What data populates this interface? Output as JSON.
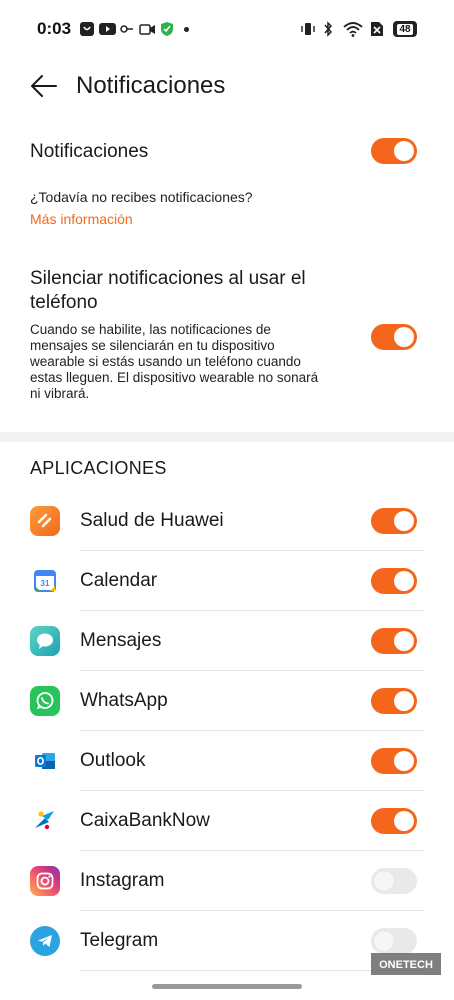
{
  "status_bar": {
    "time": "0:03",
    "battery": "48",
    "icons": [
      "notification-app-icon",
      "youtube-icon",
      "link-icon",
      "video-icon",
      "shield-icon",
      "more-dot-icon",
      "vibrate-icon",
      "bluetooth-icon",
      "wifi-icon",
      "sim-icon",
      "battery-icon"
    ]
  },
  "app_bar": {
    "title": "Notificaciones"
  },
  "notifications": {
    "label": "Notificaciones",
    "enabled": true,
    "question": "¿Todavía no recibes notificaciones?",
    "more_info": "Más información"
  },
  "silence": {
    "title_line1": "Silenciar notificaciones al usar el",
    "title_line2": "teléfono",
    "desc_line1": "Cuando se habilite, las notificaciones de",
    "desc_line2": "mensajes se silenciarán en tu dispositivo",
    "desc_line3": "wearable si estás usando un teléfono cuando",
    "desc_line4": "estas lleguen. El dispositivo wearable no sonará",
    "desc_line5": "ni vibrará.",
    "enabled": true
  },
  "apps_header": "APLICACIONES",
  "apps": [
    {
      "name": "Salud de Huawei",
      "icon": "huawei-health-icon",
      "enabled": true
    },
    {
      "name": "Calendar",
      "icon": "calendar-icon",
      "enabled": true
    },
    {
      "name": "Mensajes",
      "icon": "messages-icon",
      "enabled": true
    },
    {
      "name": "WhatsApp",
      "icon": "whatsapp-icon",
      "enabled": true
    },
    {
      "name": "Outlook",
      "icon": "outlook-icon",
      "enabled": true
    },
    {
      "name": "CaixaBankNow",
      "icon": "caixabank-icon",
      "enabled": true
    },
    {
      "name": "Instagram",
      "icon": "instagram-icon",
      "enabled": false
    },
    {
      "name": "Telegram",
      "icon": "telegram-icon",
      "enabled": false
    }
  ],
  "colors": {
    "accent": "#f4661b",
    "toggle_off": "#e9e9e9",
    "link": "#f26a1b"
  },
  "watermark": "ONETECH"
}
